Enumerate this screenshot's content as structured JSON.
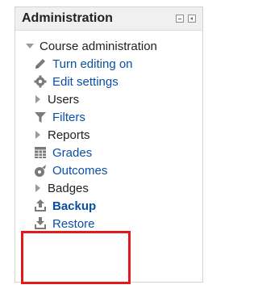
{
  "block": {
    "title": "Administration",
    "controls": [
      {
        "name": "hide-block-icon",
        "icon": "minus-box-icon"
      },
      {
        "name": "dock-block-icon",
        "icon": "dock-box-icon"
      }
    ]
  },
  "tree": {
    "root_label": "Course administration",
    "items": [
      {
        "label": "Turn editing on",
        "type": "link",
        "icon": "pencil-icon"
      },
      {
        "label": "Edit settings",
        "type": "link",
        "icon": "gear-icon"
      },
      {
        "label": "Users",
        "type": "branch"
      },
      {
        "label": "Filters",
        "type": "link",
        "icon": "filter-icon"
      },
      {
        "label": "Reports",
        "type": "branch"
      },
      {
        "label": "Grades",
        "type": "link",
        "icon": "grid-icon"
      },
      {
        "label": "Outcomes",
        "type": "link",
        "icon": "outcomes-icon"
      },
      {
        "label": "Badges",
        "type": "branch"
      },
      {
        "label": "Backup",
        "type": "link",
        "icon": "backup-icon",
        "bold": true
      },
      {
        "label": "Restore",
        "type": "link",
        "icon": "restore-icon"
      }
    ]
  },
  "colors": {
    "link": "#0b4fa3",
    "highlight": "#e11b1b",
    "icon_gray": "#7a7a7a"
  }
}
